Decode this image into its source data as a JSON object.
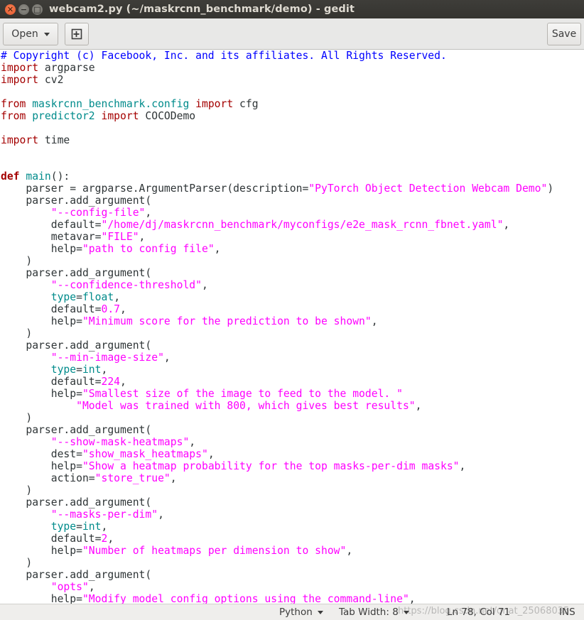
{
  "window": {
    "title": "webcam2.py (~/maskrcnn_benchmark/demo) - gedit",
    "close_glyph": "✕",
    "min_glyph": "−",
    "max_glyph": "□"
  },
  "toolbar": {
    "open_label": "Open",
    "save_label": "Save",
    "new_tab_icon": "new-document-icon"
  },
  "editor": {
    "language": "Python",
    "lines": [
      [
        [
          "cmt",
          "# Copyright (c) Facebook, Inc. and its affiliates. All Rights Reserved."
        ]
      ],
      [
        [
          "kw",
          "import"
        ],
        [
          "",
          " argparse"
        ]
      ],
      [
        [
          "kw",
          "import"
        ],
        [
          "",
          " cv2"
        ]
      ],
      [],
      [
        [
          "kw",
          "from"
        ],
        [
          "",
          " "
        ],
        [
          "mod",
          "maskrcnn_benchmark.config"
        ],
        [
          "",
          " "
        ],
        [
          "kw",
          "import"
        ],
        [
          "",
          " cfg"
        ]
      ],
      [
        [
          "kw",
          "from"
        ],
        [
          "",
          " "
        ],
        [
          "mod",
          "predictor2"
        ],
        [
          "",
          " "
        ],
        [
          "kw",
          "import"
        ],
        [
          "",
          " COCODemo"
        ]
      ],
      [],
      [
        [
          "kw",
          "import"
        ],
        [
          "",
          " time"
        ]
      ],
      [],
      [],
      [
        [
          "kw2",
          "def"
        ],
        [
          "",
          " "
        ],
        [
          "fn",
          "main"
        ],
        [
          "",
          "():"
        ]
      ],
      [
        [
          "",
          "    parser = argparse.ArgumentParser(description="
        ],
        [
          "str",
          "\"PyTorch Object Detection Webcam Demo\""
        ],
        [
          "",
          ")"
        ]
      ],
      [
        [
          "",
          "    parser.add_argument("
        ]
      ],
      [
        [
          "",
          "        "
        ],
        [
          "str",
          "\"--config-file\""
        ],
        [
          "",
          ","
        ]
      ],
      [
        [
          "",
          "        default="
        ],
        [
          "str",
          "\"/home/dj/maskrcnn_benchmark/myconfigs/e2e_mask_rcnn_fbnet.yaml\""
        ],
        [
          "",
          ","
        ]
      ],
      [
        [
          "",
          "        metavar="
        ],
        [
          "str",
          "\"FILE\""
        ],
        [
          "",
          ","
        ]
      ],
      [
        [
          "",
          "        help="
        ],
        [
          "str",
          "\"path to config file\""
        ],
        [
          "",
          ","
        ]
      ],
      [
        [
          "",
          "    )"
        ]
      ],
      [
        [
          "",
          "    parser.add_argument("
        ]
      ],
      [
        [
          "",
          "        "
        ],
        [
          "str",
          "\"--confidence-threshold\""
        ],
        [
          "",
          ","
        ]
      ],
      [
        [
          "",
          "        "
        ],
        [
          "typ",
          "type"
        ],
        [
          "",
          "="
        ],
        [
          "typ",
          "float"
        ],
        [
          "",
          ","
        ]
      ],
      [
        [
          "",
          "        default="
        ],
        [
          "num",
          "0.7"
        ],
        [
          "",
          ","
        ]
      ],
      [
        [
          "",
          "        help="
        ],
        [
          "str",
          "\"Minimum score for the prediction to be shown\""
        ],
        [
          "",
          ","
        ]
      ],
      [
        [
          "",
          "    )"
        ]
      ],
      [
        [
          "",
          "    parser.add_argument("
        ]
      ],
      [
        [
          "",
          "        "
        ],
        [
          "str",
          "\"--min-image-size\""
        ],
        [
          "",
          ","
        ]
      ],
      [
        [
          "",
          "        "
        ],
        [
          "typ",
          "type"
        ],
        [
          "",
          "="
        ],
        [
          "typ",
          "int"
        ],
        [
          "",
          ","
        ]
      ],
      [
        [
          "",
          "        default="
        ],
        [
          "num",
          "224"
        ],
        [
          "",
          ","
        ]
      ],
      [
        [
          "",
          "        help="
        ],
        [
          "str",
          "\"Smallest size of the image to feed to the model. \""
        ]
      ],
      [
        [
          "",
          "            "
        ],
        [
          "str",
          "\"Model was trained with 800, which gives best results\""
        ],
        [
          "",
          ","
        ]
      ],
      [
        [
          "",
          "    )"
        ]
      ],
      [
        [
          "",
          "    parser.add_argument("
        ]
      ],
      [
        [
          "",
          "        "
        ],
        [
          "str",
          "\"--show-mask-heatmaps\""
        ],
        [
          "",
          ","
        ]
      ],
      [
        [
          "",
          "        dest="
        ],
        [
          "str",
          "\"show_mask_heatmaps\""
        ],
        [
          "",
          ","
        ]
      ],
      [
        [
          "",
          "        help="
        ],
        [
          "str",
          "\"Show a heatmap probability for the top masks-per-dim masks\""
        ],
        [
          "",
          ","
        ]
      ],
      [
        [
          "",
          "        action="
        ],
        [
          "str",
          "\"store_true\""
        ],
        [
          "",
          ","
        ]
      ],
      [
        [
          "",
          "    )"
        ]
      ],
      [
        [
          "",
          "    parser.add_argument("
        ]
      ],
      [
        [
          "",
          "        "
        ],
        [
          "str",
          "\"--masks-per-dim\""
        ],
        [
          "",
          ","
        ]
      ],
      [
        [
          "",
          "        "
        ],
        [
          "typ",
          "type"
        ],
        [
          "",
          "="
        ],
        [
          "typ",
          "int"
        ],
        [
          "",
          ","
        ]
      ],
      [
        [
          "",
          "        default="
        ],
        [
          "num",
          "2"
        ],
        [
          "",
          ","
        ]
      ],
      [
        [
          "",
          "        help="
        ],
        [
          "str",
          "\"Number of heatmaps per dimension to show\""
        ],
        [
          "",
          ","
        ]
      ],
      [
        [
          "",
          "    )"
        ]
      ],
      [
        [
          "",
          "    parser.add_argument("
        ]
      ],
      [
        [
          "",
          "        "
        ],
        [
          "str",
          "\"opts\""
        ],
        [
          "",
          ","
        ]
      ],
      [
        [
          "",
          "        help="
        ],
        [
          "str",
          "\"Modify model config options using the command-line\""
        ],
        [
          "",
          ","
        ]
      ]
    ]
  },
  "statusbar": {
    "language": "Python",
    "tab_width": "Tab Width: 8",
    "position": "Ln 78, Col 71",
    "mode": "INS",
    "watermark": "https://blog.csdn.net/qnat_25068035"
  },
  "colors": {
    "keyword": "#a40000",
    "string": "#ff00ff",
    "comment": "#0000ff",
    "module": "#008b8b"
  }
}
